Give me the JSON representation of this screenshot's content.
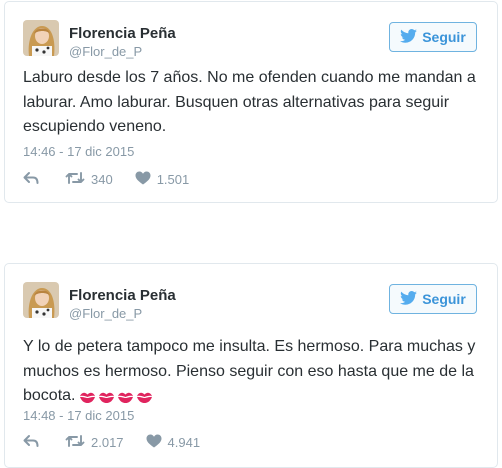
{
  "tweets": [
    {
      "author": {
        "name": "Florencia Peña",
        "handle": "@Flor_de_P"
      },
      "follow_label": "Seguir",
      "text": "Laburo desde los 7 años. No me ofenden cuando me mandan a laburar. Amo laburar. Busquen otras alternativas para seguir escupiendo veneno.",
      "timestamp": "14:46 - 17 dic 2015",
      "retweets": "340",
      "likes": "1.501"
    },
    {
      "author": {
        "name": "Florencia Peña",
        "handle": "@Flor_de_P"
      },
      "follow_label": "Seguir",
      "text": "Y lo de petera tampoco me insulta. Es hermoso. Para muchas y muchos es hermoso. Pienso seguir con eso hasta que me de la bocota.",
      "emoji": "💋💋💋💋",
      "timestamp": "14:48 - 17 dic 2015",
      "retweets": "2.017",
      "likes": "4.941"
    }
  ],
  "icons": {
    "bird": "twitter-bird-icon",
    "reply": "reply-icon",
    "retweet": "retweet-icon",
    "like": "heart-icon",
    "kiss": "kiss-mark-icon"
  },
  "colors": {
    "accent": "#3b94d9",
    "kiss": "#e0245e",
    "muted": "#8899a6",
    "text": "#292f33"
  }
}
